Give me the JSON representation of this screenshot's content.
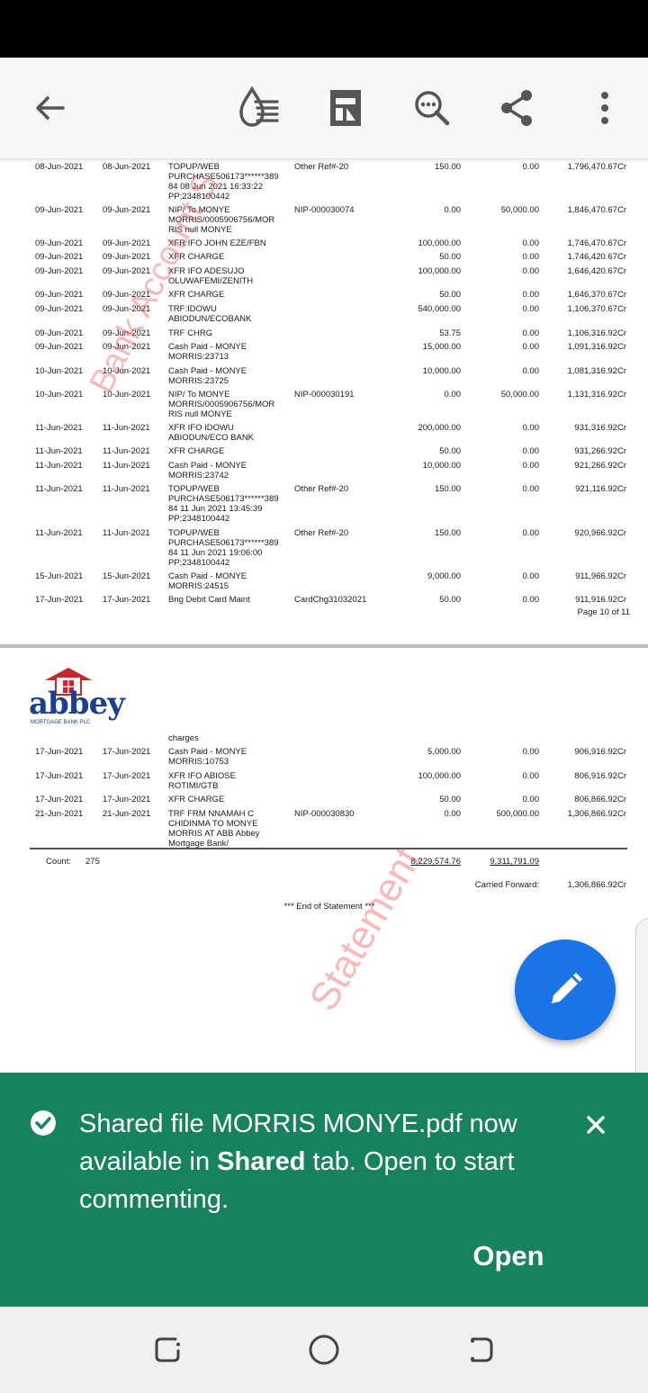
{
  "toolbar": {
    "back_icon": "arrow-left-icon",
    "icons": [
      "liquid-mode-icon",
      "page-view-icon",
      "search-icon",
      "share-icon",
      "more-vert-icon"
    ]
  },
  "statement": {
    "page1_rows": [
      {
        "date": "08-Jun-2021",
        "value_date": "08-Jun-2021",
        "description": "TOPUP/WEB\nPURCHASE506173******389\n84 08 Jun 2021 16:33:22\nPP;2348100442",
        "ref": "Other Ref#-20",
        "debit": "150.00",
        "credit": "0.00",
        "balance": "1,796,470.67Cr"
      },
      {
        "date": "09-Jun-2021",
        "value_date": "09-Jun-2021",
        "description": "NIP/ To MONYE\nMORRIS/0005906756/MOR\nRIS null MONYE",
        "ref": "NIP-000030074",
        "debit": "0.00",
        "credit": "50,000.00",
        "balance": "1,846,470.67Cr"
      },
      {
        "date": "09-Jun-2021",
        "value_date": "09-Jun-2021",
        "description": "XFR IFO JOHN EZE/FBN",
        "ref": "",
        "debit": "100,000.00",
        "credit": "0.00",
        "balance": "1,746,470.67Cr"
      },
      {
        "date": "09-Jun-2021",
        "value_date": "09-Jun-2021",
        "description": "XFR CHARGE",
        "ref": "",
        "debit": "50.00",
        "credit": "0.00",
        "balance": "1,746,420.67Cr"
      },
      {
        "date": "09-Jun-2021",
        "value_date": "09-Jun-2021",
        "description": "XFR IFO ADESUJO\nOLUWAFEMI/ZENITH",
        "ref": "",
        "debit": "100,000.00",
        "credit": "0.00",
        "balance": "1,646,420.67Cr"
      },
      {
        "date": "09-Jun-2021",
        "value_date": "09-Jun-2021",
        "description": "XFR CHARGE",
        "ref": "",
        "debit": "50.00",
        "credit": "0.00",
        "balance": "1,646,370.67Cr"
      },
      {
        "date": "09-Jun-2021",
        "value_date": "09-Jun-2021",
        "description": "TRF:IDOWU\nABIODUN/ECOBANK",
        "ref": "",
        "debit": "540,000.00",
        "credit": "0.00",
        "balance": "1,106,370.67Cr"
      },
      {
        "date": "09-Jun-2021",
        "value_date": "09-Jun-2021",
        "description": "TRF CHRG",
        "ref": "",
        "debit": "53.75",
        "credit": "0.00",
        "balance": "1,106,316.92Cr"
      },
      {
        "date": "09-Jun-2021",
        "value_date": "09-Jun-2021",
        "description": "Cash Paid - MONYE\nMORRIS:23713",
        "ref": "",
        "debit": "15,000.00",
        "credit": "0.00",
        "balance": "1,091,316.92Cr"
      },
      {
        "date": "10-Jun-2021",
        "value_date": "10-Jun-2021",
        "description": "Cash Paid - MONYE\nMORRIS:23725",
        "ref": "",
        "debit": "10,000.00",
        "credit": "0.00",
        "balance": "1,081,316.92Cr"
      },
      {
        "date": "10-Jun-2021",
        "value_date": "10-Jun-2021",
        "description": "NIP/ To MONYE\nMORRIS/0005906756/MOR\nRIS null MONYE",
        "ref": "NIP-000030191",
        "debit": "0.00",
        "credit": "50,000.00",
        "balance": "1,131,316.92Cr"
      },
      {
        "date": "11-Jun-2021",
        "value_date": "11-Jun-2021",
        "description": "XFR IFO IDOWU\nABIODUN/ECO BANK",
        "ref": "",
        "debit": "200,000.00",
        "credit": "0.00",
        "balance": "931,316.92Cr"
      },
      {
        "date": "11-Jun-2021",
        "value_date": "11-Jun-2021",
        "description": "XFR CHARGE",
        "ref": "",
        "debit": "50.00",
        "credit": "0.00",
        "balance": "931,266.92Cr"
      },
      {
        "date": "11-Jun-2021",
        "value_date": "11-Jun-2021",
        "description": "Cash Paid - MONYE\nMORRIS:23742",
        "ref": "",
        "debit": "10,000.00",
        "credit": "0.00",
        "balance": "921,266.92Cr"
      },
      {
        "date": "11-Jun-2021",
        "value_date": "11-Jun-2021",
        "description": "TOPUP/WEB\nPURCHASE506173******389\n84 11 Jun 2021 13:45:39\nPP;2348100442",
        "ref": "Other Ref#-20",
        "debit": "150.00",
        "credit": "0.00",
        "balance": "921,116.92Cr"
      },
      {
        "date": "11-Jun-2021",
        "value_date": "11-Jun-2021",
        "description": "TOPUP/WEB\nPURCHASE506173******389\n84 11 Jun 2021 19:06:00\nPP;2348100442",
        "ref": "Other Ref#-20",
        "debit": "150.00",
        "credit": "0.00",
        "balance": "920,966.92Cr"
      },
      {
        "date": "15-Jun-2021",
        "value_date": "15-Jun-2021",
        "description": "Cash Paid - MONYE\nMORRIS:24515",
        "ref": "",
        "debit": "9,000.00",
        "credit": "0.00",
        "balance": "911,966.92Cr"
      },
      {
        "date": "17-Jun-2021",
        "value_date": "17-Jun-2021",
        "description": "Bng Debit Card Maint",
        "ref": "CardChg31032021",
        "debit": "50.00",
        "credit": "0.00",
        "balance": "911,916.92Cr"
      }
    ],
    "page_label": "Page 10 of 11",
    "logo_text": "abbey",
    "logo_subtext": "MORTGAGE BANK PLC",
    "carry_desc": "charges",
    "page2_rows": [
      {
        "date": "17-Jun-2021",
        "value_date": "17-Jun-2021",
        "description": "Cash Paid - MONYE\nMORRIS:10753",
        "ref": "",
        "debit": "5,000.00",
        "credit": "0.00",
        "balance": "906,916.92Cr"
      },
      {
        "date": "17-Jun-2021",
        "value_date": "17-Jun-2021",
        "description": "XFR IFO ABIOSE\nROTIMI/GTB",
        "ref": "",
        "debit": "100,000.00",
        "credit": "0.00",
        "balance": "806,916.92Cr"
      },
      {
        "date": "17-Jun-2021",
        "value_date": "17-Jun-2021",
        "description": "XFR CHARGE",
        "ref": "",
        "debit": "50.00",
        "credit": "0.00",
        "balance": "806,866.92Cr"
      },
      {
        "date": "21-Jun-2021",
        "value_date": "21-Jun-2021",
        "description": "TRF FRM NNAMAH C\nCHIDINMA TO MONYE\nMORRIS AT ABB  Abbey\nMortgage Bank/",
        "ref": "NIP-000030830",
        "debit": "0.00",
        "credit": "500,000.00",
        "balance": "1,306,866.92Cr"
      }
    ],
    "count_label": "Count:",
    "count_value": "275",
    "total_debit": "8,229,574.76",
    "total_credit": "9,311,791.09",
    "carried_forward_label": "Carried Forward:",
    "carried_forward_value": "1,306,866.92Cr",
    "end_label": "*** End of Statement ***",
    "watermark_1": "Bank Account S",
    "watermark_2": "Statement"
  },
  "fab": {
    "icon": "pencil-edit-icon"
  },
  "snackbar": {
    "icon": "check-circle-icon",
    "message_part1": "Shared file MORRIS MONYE.pdf now available in ",
    "message_bold": "Shared",
    "message_part2": " tab. Open to start commenting.",
    "close_icon": "close-icon",
    "action_label": "Open"
  },
  "nav": {
    "icons": [
      "recents-icon",
      "home-icon",
      "back-icon"
    ]
  },
  "colors": {
    "snackbar_bg": "#17835e",
    "fab_bg": "#1a73e8",
    "watermark": "#ee4646",
    "logo_red": "#c62828",
    "logo_blue": "#1e3f8f"
  }
}
